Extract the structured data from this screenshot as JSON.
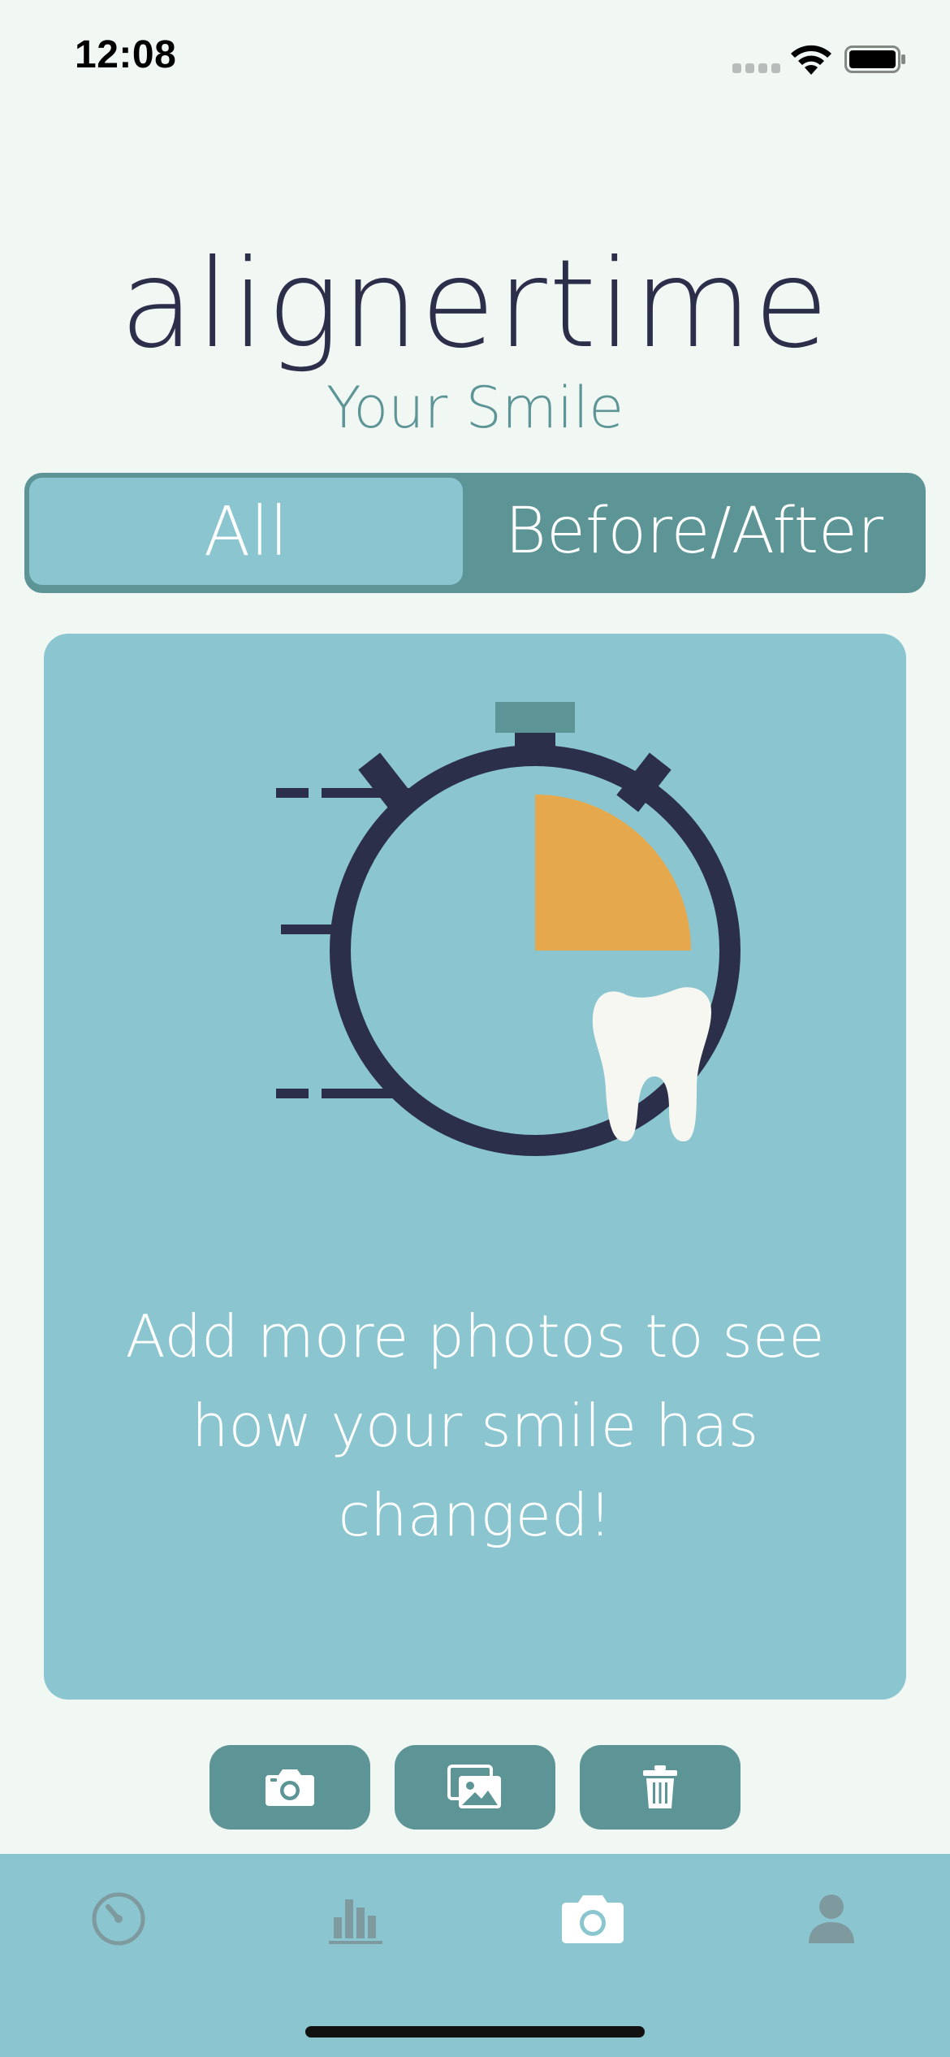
{
  "status_bar": {
    "time": "12:08"
  },
  "header": {
    "app_title": "alignertime",
    "page_subtitle": "Your Smile"
  },
  "segmented_control": {
    "options": [
      "All",
      "Before/After"
    ],
    "selected": "All"
  },
  "card": {
    "message": "Add more photos to see how your smile has changed!"
  },
  "actions": [
    {
      "icon": "camera-icon"
    },
    {
      "icon": "photo-gallery-icon"
    },
    {
      "icon": "trash-icon"
    }
  ],
  "tab_bar": {
    "tabs": [
      {
        "icon": "timer-icon",
        "active": false
      },
      {
        "icon": "bar-chart-icon",
        "active": false
      },
      {
        "icon": "camera-icon",
        "active": true
      },
      {
        "icon": "profile-icon",
        "active": false
      }
    ]
  },
  "colors": {
    "background": "#F1F7F3",
    "teal_dark": "#5D9596",
    "teal_light": "#8BC6D0",
    "navy": "#2C2F4A",
    "orange": "#E6A84D",
    "tab_inactive": "#7E9A9E"
  }
}
